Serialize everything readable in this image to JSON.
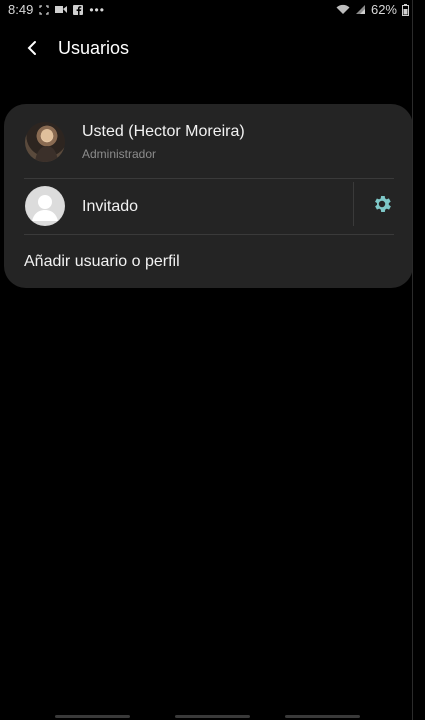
{
  "status_bar": {
    "time": "8:49",
    "left_icons": [
      "expand-icon",
      "video-icon",
      "facebook-icon",
      "more-dots-icon"
    ],
    "battery": "62%"
  },
  "header": {
    "title": "Usuarios"
  },
  "users": [
    {
      "name": "Usted (Hector Moreira)",
      "role": "Administrador"
    },
    {
      "name": "Invitado"
    }
  ],
  "add_user_label": "Añadir usuario o perfil",
  "colors": {
    "background": "#000000",
    "card": "#242424",
    "accent": "#7ec8c8"
  }
}
